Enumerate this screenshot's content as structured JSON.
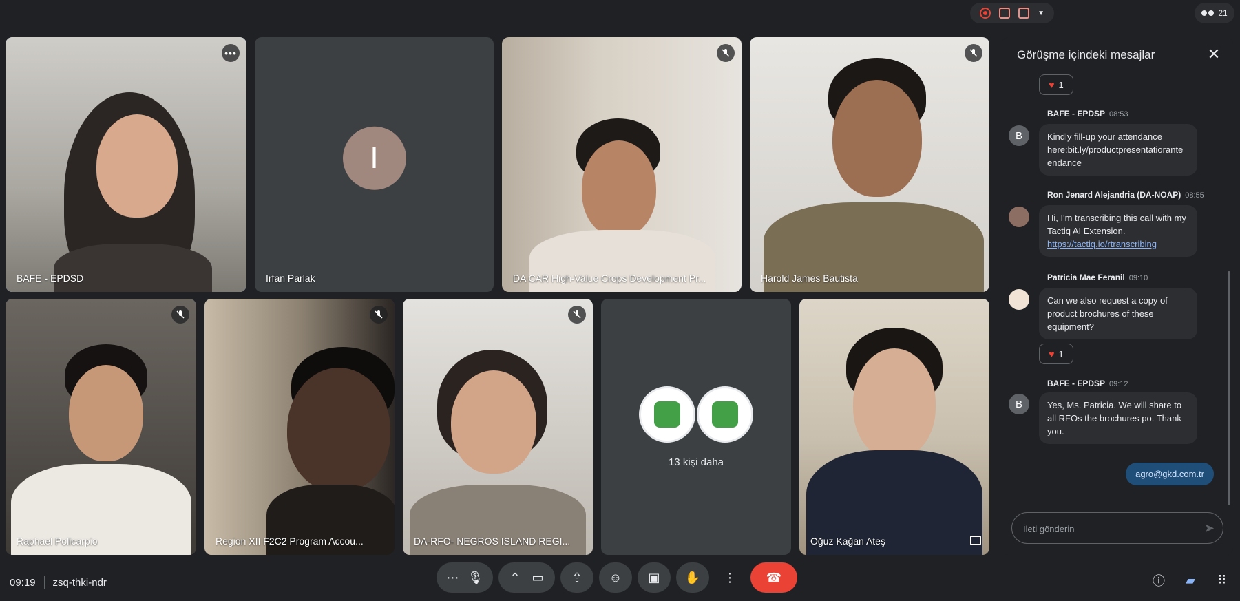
{
  "top_bar": {
    "participant_count": "21"
  },
  "tiles": [
    {
      "name": "BAFE - EPDSD"
    },
    {
      "name": "Irfan Parlak",
      "initial": "I"
    },
    {
      "name": "DA CAR High-Value Crops Development Pr..."
    },
    {
      "name": "Harold James Bautista"
    },
    {
      "name": "Raphael Policarpio"
    },
    {
      "name": "Region XII F2C2 Program Accou..."
    },
    {
      "name": "DA-RFO- NEGROS ISLAND REGI..."
    },
    {
      "name": "13 kişi daha"
    },
    {
      "name": "Oğuz Kağan Ateş"
    }
  ],
  "chat": {
    "title": "Görüşme içindeki mesajlar",
    "reaction_1": {
      "icon": "heart",
      "count": "1"
    },
    "messages": [
      {
        "sender": "BAFE - EPDSP",
        "time": "08:53",
        "avatar": "B",
        "text": "Kindly fill-up your attendance here:bit.ly/productpresentatiorante endance"
      },
      {
        "sender": "Ron Jenard Alejandria (DA-NOAP)",
        "time": "08:55",
        "text": "Hi, I'm transcribing this call with my Tactiq AI Extension.",
        "link": "https://tactiq.io/rtranscribing"
      },
      {
        "sender": "Patricia Mae Feranil",
        "time": "09:10",
        "text": "Can we also request a copy of product brochures of these equipment?"
      },
      {
        "sender": "BAFE - EPDSP",
        "time": "09:12",
        "avatar": "B",
        "text": "Yes, Ms. Patricia. We will share to all RFOs the brochures po. Thank you."
      }
    ],
    "reaction_2": {
      "icon": "heart",
      "count": "1"
    },
    "own_message": "agro@gkd.com.tr",
    "input_placeholder": "İleti gönderin"
  },
  "bottom": {
    "time": "09:19",
    "meeting_code": "zsq-thki-ndr"
  }
}
